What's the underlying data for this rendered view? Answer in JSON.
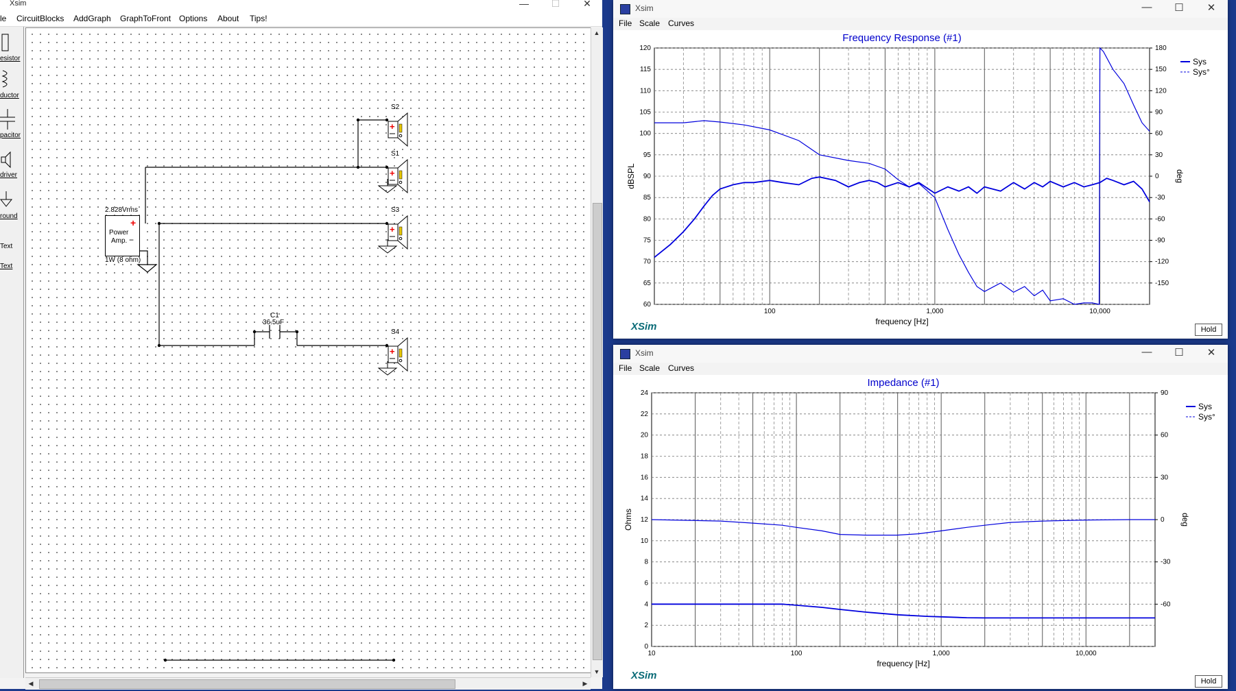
{
  "main_window": {
    "title": "Xsim",
    "controls": {
      "minimize": "—",
      "maximize": "☐",
      "close": "✕"
    },
    "menu": [
      "le",
      "CircuitBlocks",
      "AddGraph",
      "GraphToFront",
      "Options",
      "About",
      "Tips!"
    ],
    "palette": [
      "esistor",
      "ductor",
      "pacitor",
      "driver",
      "round",
      "Text",
      "Text"
    ],
    "circuit": {
      "speakers": [
        "S2",
        "S1",
        "S3",
        "S4"
      ],
      "power_amp": {
        "voltage": "2.828Vrms",
        "label_line1": "Power",
        "label_line2": "Amp.",
        "rating": "1W (8 ohm)"
      },
      "capacitor": {
        "name": "C1",
        "value": "36.5uF"
      }
    }
  },
  "freq_window": {
    "title": "Xsim",
    "menu": [
      "File",
      "Scale",
      "Curves"
    ],
    "hold": "Hold",
    "logo": "XSim",
    "chart": {
      "title": "Frequency Response (#1)",
      "ylabel": "dBSPL",
      "y2label": "deg",
      "xlabel": "frequency [Hz]",
      "x_ticks": [
        "100",
        "1,000",
        "10,000"
      ],
      "y_ticks": [
        "120",
        "115",
        "110",
        "105",
        "100",
        "95",
        "90",
        "85",
        "80",
        "75",
        "70",
        "65",
        "60"
      ],
      "y2_ticks": [
        "180",
        "150",
        "120",
        "90",
        "60",
        "30",
        "0",
        "-30",
        "-60",
        "-90",
        "-120",
        "-150"
      ],
      "legend": [
        "Sys",
        "Sys°"
      ]
    }
  },
  "imp_window": {
    "title": "Xsim",
    "menu": [
      "File",
      "Scale",
      "Curves"
    ],
    "hold": "Hold",
    "logo": "XSim",
    "chart": {
      "title": "Impedance (#1)",
      "ylabel": "Ohms",
      "y2label": "deg",
      "xlabel": "frequency [Hz]",
      "x_ticks": [
        "10",
        "100",
        "1,000",
        "10,000"
      ],
      "y_ticks": [
        "24",
        "22",
        "20",
        "18",
        "16",
        "14",
        "12",
        "10",
        "8",
        "6",
        "4",
        "2",
        "0"
      ],
      "y2_ticks": [
        "90",
        "60",
        "30",
        "0",
        "-30",
        "-60"
      ],
      "legend": [
        "Sys",
        "Sys°"
      ]
    }
  },
  "chart_data": [
    {
      "type": "line",
      "title": "Frequency Response (#1)",
      "xlabel": "frequency [Hz]",
      "ylabel": "dBSPL",
      "y2label": "deg",
      "x_scale": "log",
      "xlim": [
        20,
        20000
      ],
      "ylim": [
        60,
        120
      ],
      "y2lim": [
        -180,
        180
      ],
      "legend_position": "right",
      "series": [
        {
          "name": "Sys",
          "axis": "left",
          "color": "#0000dd",
          "x": [
            20,
            25,
            30,
            35,
            40,
            45,
            50,
            60,
            70,
            80,
            100,
            120,
            150,
            180,
            200,
            250,
            300,
            350,
            400,
            450,
            500,
            600,
            700,
            800,
            1000,
            1200,
            1400,
            1600,
            1800,
            2000,
            2500,
            3000,
            3500,
            4000,
            4500,
            5000,
            6000,
            7000,
            8000,
            9000,
            10000,
            11000,
            12000,
            14000,
            16000,
            18000,
            20000
          ],
          "y": [
            71,
            74,
            77,
            80,
            83,
            85.5,
            87,
            88,
            88.5,
            88.5,
            89,
            88.5,
            88,
            89.5,
            89.8,
            89,
            87.5,
            88.5,
            89,
            88.5,
            87.5,
            88.5,
            87.5,
            88.5,
            86,
            87.5,
            86.5,
            87.5,
            86,
            87.5,
            86.5,
            88.5,
            87,
            88.5,
            87.5,
            88.8,
            87.5,
            88.5,
            87.5,
            88,
            88.5,
            89.5,
            89,
            88,
            88.8,
            87,
            84
          ]
        },
        {
          "name": "Sys°",
          "axis": "right",
          "color": "#0000dd",
          "x": [
            20,
            30,
            40,
            50,
            70,
            100,
            150,
            200,
            300,
            400,
            500,
            600,
            700,
            800,
            1000,
            1200,
            1400,
            1600,
            1800,
            2000,
            2500,
            3000,
            3500,
            4000,
            4500,
            5000,
            6000,
            7000,
            8000,
            9000,
            9900,
            10000,
            10500,
            12000,
            14000,
            16000,
            18000,
            20000
          ],
          "y": [
            75,
            75,
            78,
            76,
            72,
            65,
            50,
            30,
            22,
            18,
            10,
            -5,
            -15,
            -10,
            -30,
            -75,
            -110,
            -135,
            -155,
            -162,
            -150,
            -163,
            -155,
            -168,
            -160,
            -175,
            -172,
            -180,
            -178,
            -178,
            -180,
            180,
            175,
            150,
            130,
            100,
            75,
            63
          ]
        }
      ]
    },
    {
      "type": "line",
      "title": "Impedance (#1)",
      "xlabel": "frequency [Hz]",
      "ylabel": "Ohms",
      "y2label": "deg",
      "x_scale": "log",
      "xlim": [
        10,
        30000
      ],
      "ylim": [
        0,
        24
      ],
      "y2lim": [
        -90,
        90
      ],
      "legend_position": "right",
      "series": [
        {
          "name": "Sys",
          "axis": "left",
          "color": "#0000dd",
          "x": [
            10,
            30,
            50,
            80,
            100,
            150,
            200,
            300,
            500,
            800,
            1000,
            1500,
            2000,
            3000,
            5000,
            10000,
            20000,
            30000
          ],
          "y": [
            4.0,
            4.0,
            4.0,
            4.0,
            3.9,
            3.7,
            3.5,
            3.25,
            3.0,
            2.85,
            2.8,
            2.72,
            2.7,
            2.7,
            2.7,
            2.7,
            2.7,
            2.7
          ]
        },
        {
          "name": "Sys°",
          "axis": "right",
          "color": "#0000dd",
          "x": [
            10,
            30,
            50,
            80,
            100,
            150,
            200,
            300,
            500,
            700,
            1000,
            1500,
            2000,
            3000,
            5000,
            10000,
            20000,
            30000
          ],
          "y": [
            0,
            -1,
            -2.5,
            -4,
            -5.5,
            -8,
            -10.5,
            -11,
            -11,
            -10,
            -8,
            -5.5,
            -4,
            -2,
            -1,
            -0.3,
            0,
            0
          ]
        }
      ]
    }
  ]
}
